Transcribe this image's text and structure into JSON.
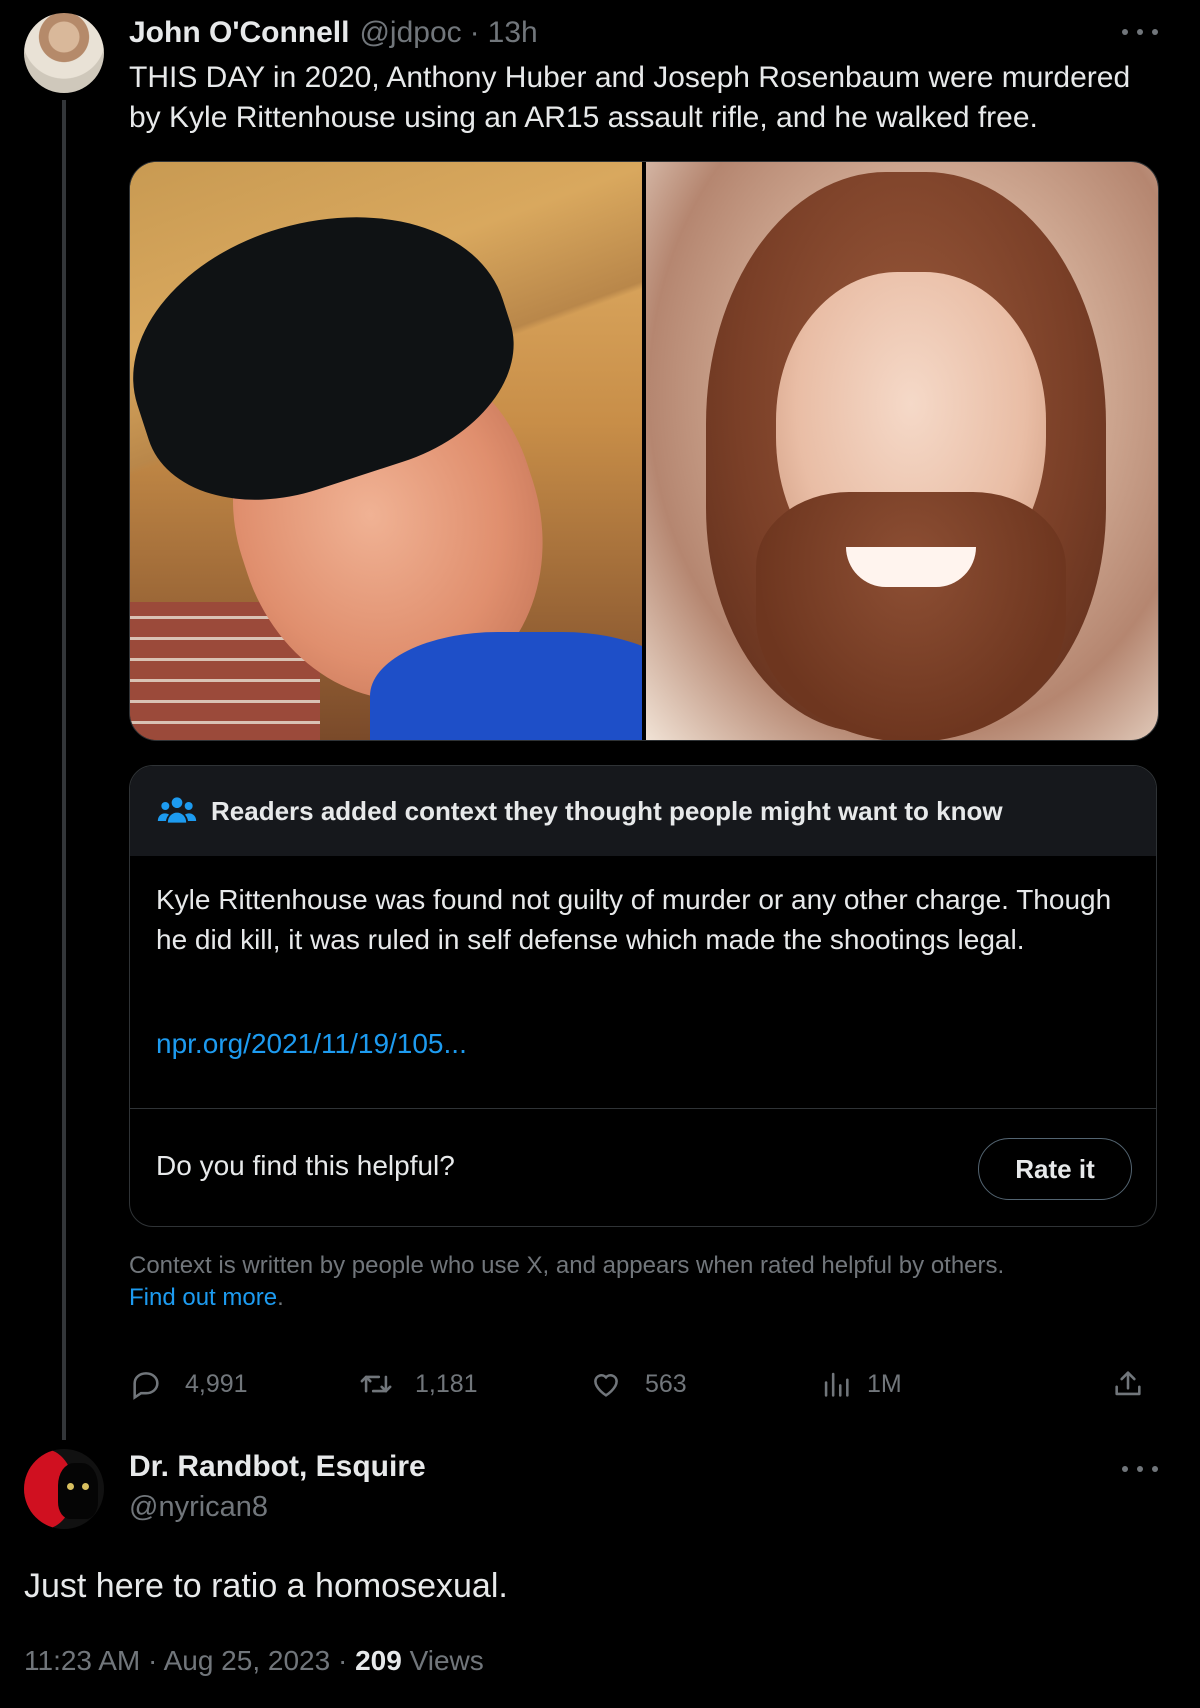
{
  "parent_tweet": {
    "avatar_icon": "user-avatar-john",
    "display_name": "John O'Connell",
    "handle": "@jdpoc",
    "separator": "·",
    "time_ago": "13h",
    "text": "THIS DAY in 2020, Anthony Huber and Joseph Rosenbaum were murdered by Kyle Rittenhouse using an AR15 assault rifle, and he walked free.",
    "media": {
      "left_photo": "photo-man-black-beanie",
      "right_photo": "photo-man-long-hair-beard"
    },
    "community_note": {
      "icon": "people-icon",
      "title": "Readers added context they thought people might want to know",
      "body": "Kyle Rittenhouse was found not guilty of murder or any other charge. Though he did kill, it was ruled in self defense which made the shootings legal.",
      "link": "npr.org/2021/11/19/105...",
      "helpful_question": "Do you find this helpful?",
      "rate_label": "Rate it",
      "disclaimer": "Context is written by people who use X, and appears when rated helpful by others.",
      "find_out_more": "Find out more",
      "disclaimer_end": "."
    },
    "actions": {
      "replies": "4,991",
      "reposts": "1,181",
      "likes": "563",
      "views": "1M"
    }
  },
  "reply_tweet": {
    "avatar_icon": "user-avatar-cat",
    "display_name": "Dr. Randbot, Esquire",
    "handle": "@nyrican8",
    "text": "Just here to ratio a homosexual.",
    "time": "11:23 AM",
    "separator": "·",
    "date": "Aug 25, 2023",
    "separator2": "·",
    "views_count": "209",
    "views_label": "Views"
  },
  "colors": {
    "background": "#000000",
    "text_primary": "#e7e9ea",
    "text_secondary": "#71767b",
    "accent_blue": "#1d9bf0",
    "border": "#2f3336",
    "note_header_bg": "#16181c"
  }
}
